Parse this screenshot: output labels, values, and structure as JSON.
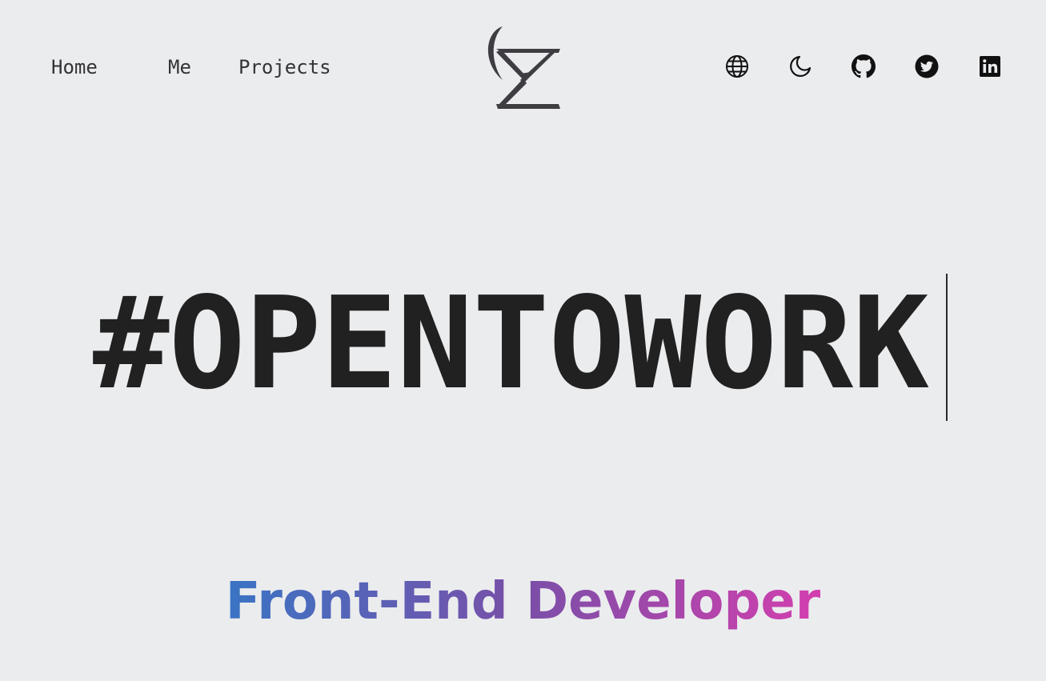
{
  "nav": {
    "links": [
      {
        "label": "Home"
      },
      {
        "label": "Me"
      },
      {
        "label": "Projects"
      }
    ]
  },
  "header": {
    "logo_icon": "sigma-satellite-logo-icon",
    "actions": [
      {
        "icon": "globe-icon",
        "purpose": "language"
      },
      {
        "icon": "moon-icon",
        "purpose": "dark-mode-toggle"
      },
      {
        "icon": "github-icon",
        "purpose": "github"
      },
      {
        "icon": "twitter-icon",
        "purpose": "twitter"
      },
      {
        "icon": "linkedin-icon",
        "purpose": "linkedin"
      }
    ]
  },
  "hero": {
    "headline": "#OPENTOWORK",
    "subtitle": "Front-End Developer"
  },
  "colors": {
    "background": "#ebecee",
    "text": "#212121",
    "gradient_start": "#3a74c4",
    "gradient_mid": "#7a4fa8",
    "gradient_end": "#d33fae"
  }
}
